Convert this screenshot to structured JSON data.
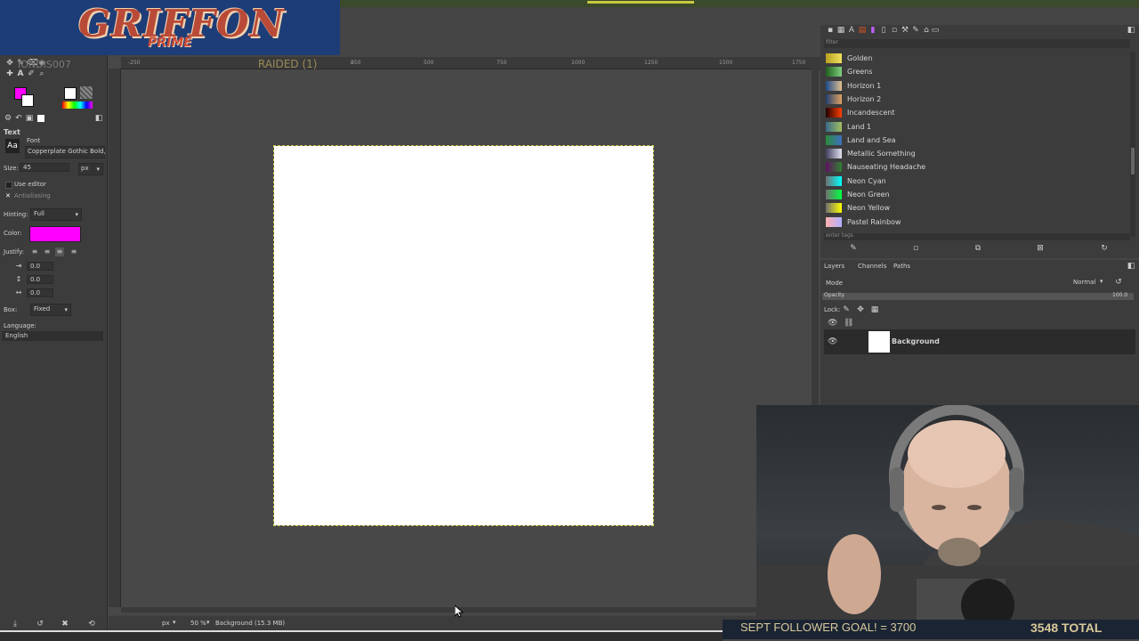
{
  "overlay": {
    "logo_main": "GRIFFON",
    "logo_sub": "PRIME",
    "raided": "RAIDED (1)",
    "username": "IONDIS007",
    "goal": "SEPT FOLLOWER GOAL! = 3700",
    "total": "3548 TOTAL"
  },
  "toolbox": {
    "tool_title": "Text",
    "font_label": "Font",
    "font_value": "Copperplate Gothic Bold,",
    "size_label": "Size:",
    "size_value": "45",
    "size_unit": "px",
    "use_editor": "Use editor",
    "antialiasing": "Antialiasing",
    "hinting_label": "Hinting:",
    "hinting_value": "Full",
    "color_label": "Color:",
    "color_hex": "#ff00ff",
    "justify_label": "Justify:",
    "indent_value": "0.0",
    "line_spacing_value": "0.0",
    "letter_spacing_value": "0.0",
    "box_label": "Box:",
    "box_value": "Fixed",
    "language_label": "Language:",
    "language_value": "English"
  },
  "ruler": {
    "h_ticks": [
      "-250",
      "0",
      "250",
      "500",
      "750",
      "1000",
      "1250",
      "1500",
      "1750"
    ]
  },
  "statusbar": {
    "unit": "px",
    "zoom": "50 %",
    "info": "Background (15.3 MB)"
  },
  "gradients": {
    "filter_placeholder": "filter",
    "tag_placeholder": "enter tags",
    "items": [
      {
        "name": "Golden",
        "colors": [
          "#b8a020",
          "#f0e060"
        ]
      },
      {
        "name": "Greens",
        "colors": [
          "#1e5e1e",
          "#7fd07f"
        ]
      },
      {
        "name": "Horizon 1",
        "colors": [
          "#1d4a8a",
          "#e0c090"
        ]
      },
      {
        "name": "Horizon 2",
        "colors": [
          "#204070",
          "#e0a060"
        ]
      },
      {
        "name": "Incandescent",
        "colors": [
          "#200000",
          "#ff4000"
        ]
      },
      {
        "name": "Land 1",
        "colors": [
          "#3a6a8a",
          "#a0c060"
        ]
      },
      {
        "name": "Land and Sea",
        "colors": [
          "#2a8a3a",
          "#4070c0"
        ]
      },
      {
        "name": "Metallic Something",
        "colors": [
          "#404060",
          "#e0e0f0"
        ]
      },
      {
        "name": "Nauseating Headache",
        "colors": [
          "#601060",
          "#308030"
        ]
      },
      {
        "name": "Neon Cyan",
        "colors": [
          "#707070",
          "#00ffff"
        ]
      },
      {
        "name": "Neon Green",
        "colors": [
          "#707070",
          "#00ff40"
        ]
      },
      {
        "name": "Neon Yellow",
        "colors": [
          "#707070",
          "#ffff00"
        ]
      },
      {
        "name": "Pastel Rainbow",
        "colors": [
          "#ffb0b0",
          "#b0b0ff"
        ]
      }
    ]
  },
  "layers": {
    "tabs": [
      "Layers",
      "Channels",
      "Paths"
    ],
    "mode_label": "Mode",
    "mode_value": "Normal",
    "opacity_label": "Opacity",
    "opacity_value": "100.0",
    "lock_label": "Lock:",
    "layer_name": "Background"
  }
}
